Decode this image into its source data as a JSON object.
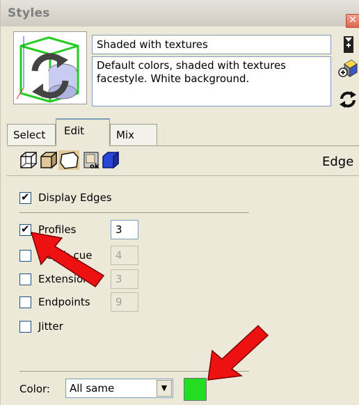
{
  "window": {
    "title": "Styles",
    "close_glyph": "✕"
  },
  "style": {
    "name": "Shaded with textures",
    "description": "Default colors, shaded with textures facestyle. White background."
  },
  "header_icons": [
    "create-new-style-icon",
    "update-style-icon",
    "refresh-icon"
  ],
  "tabs": [
    {
      "label": "Select",
      "active": false
    },
    {
      "label": "Edit",
      "active": true
    },
    {
      "label": "Mix",
      "active": false
    }
  ],
  "edit_toolbar": {
    "icons": [
      "edge-settings-icon",
      "face-settings-icon",
      "background-settings-icon",
      "watermark-settings-icon",
      "modeling-settings-icon"
    ],
    "section_title": "Edge"
  },
  "edge_settings": {
    "display_edges": {
      "label": "Display Edges",
      "checked": true
    },
    "profiles": {
      "label": "Profiles",
      "checked": true,
      "value": "3",
      "enabled": true
    },
    "depth_cue": {
      "label": "Depth cue",
      "checked": false,
      "value": "4",
      "enabled": false
    },
    "extension": {
      "label": "Extension",
      "checked": false,
      "value": "3",
      "enabled": false
    },
    "endpoints": {
      "label": "Endpoints",
      "checked": false,
      "value": "9",
      "enabled": false
    },
    "jitter": {
      "label": "Jitter",
      "checked": false
    },
    "color": {
      "label": "Color:",
      "selected": "All same",
      "swatch": "#22dd22"
    }
  },
  "colors": {
    "panel_bg": "#ece9d8",
    "annotation_arrow": "#ee1111"
  }
}
